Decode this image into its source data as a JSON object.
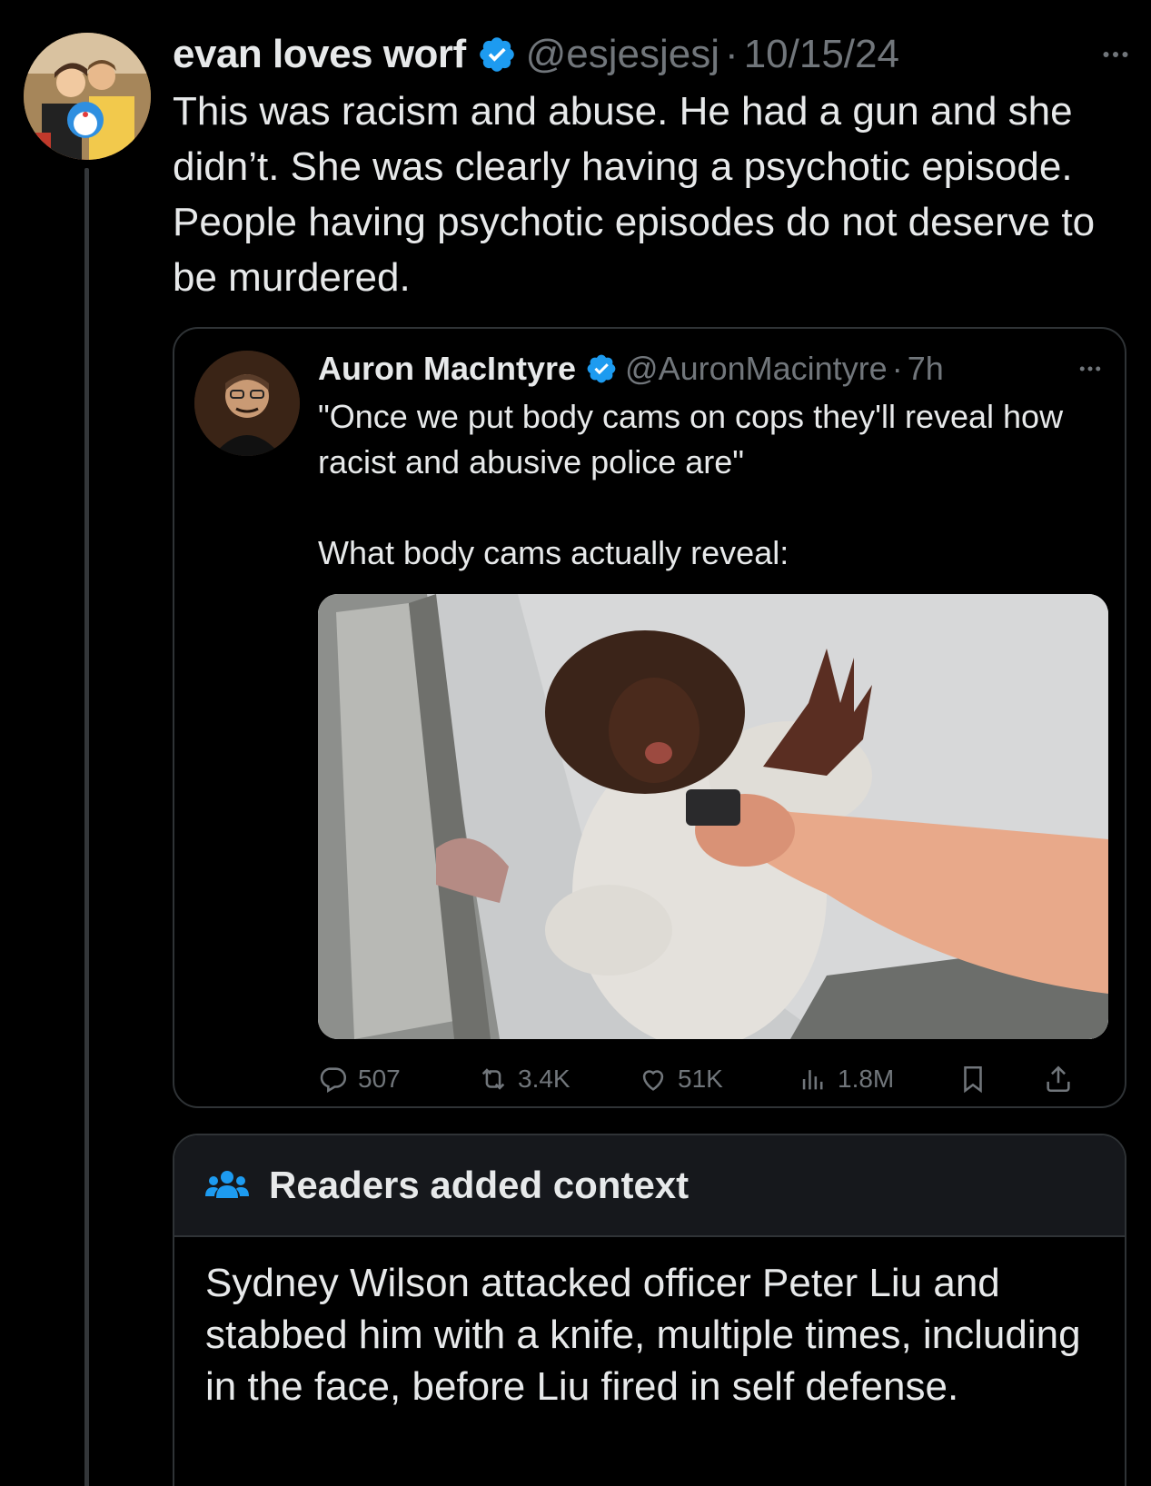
{
  "tweet": {
    "display_name": "evan loves worf",
    "handle": "@esjesjesj",
    "separator": "·",
    "date": "10/15/24",
    "text": "This was racism and abuse. He had a gun and she didn’t. She was clearly having a psychotic episode. People having psychotic episodes do not deserve to be murdered."
  },
  "quoted_tweet": {
    "display_name": "Auron MacIntyre",
    "handle": "@AuronMacintyre",
    "separator": "·",
    "time": "7h",
    "text": "\"Once we put body cams on cops they'll reveal how racist and abusive police are\"\n\nWhat body cams actually reveal:",
    "stats": {
      "replies": "507",
      "reposts": "3.4K",
      "likes": "51K",
      "views": "1.8M"
    }
  },
  "community_note": {
    "title": "Readers added context",
    "text": "Sydney Wilson attacked officer Peter Liu and stabbed him with a knife, multiple times, including in the face, before Liu fired in self defense."
  },
  "icons": {
    "verified": "verified-badge-icon",
    "more": "more-icon",
    "reply": "reply-icon",
    "repost": "repost-icon",
    "like": "like-icon",
    "views": "views-icon",
    "bookmark": "bookmark-icon",
    "share": "share-icon",
    "notes": "people-icon"
  },
  "colors": {
    "background": "#000000",
    "text_primary": "#e7e9ea",
    "text_secondary": "#71767b",
    "border": "#2f3336",
    "verified_blue": "#1d9bf0",
    "notes_header_bg": "#16181c"
  }
}
